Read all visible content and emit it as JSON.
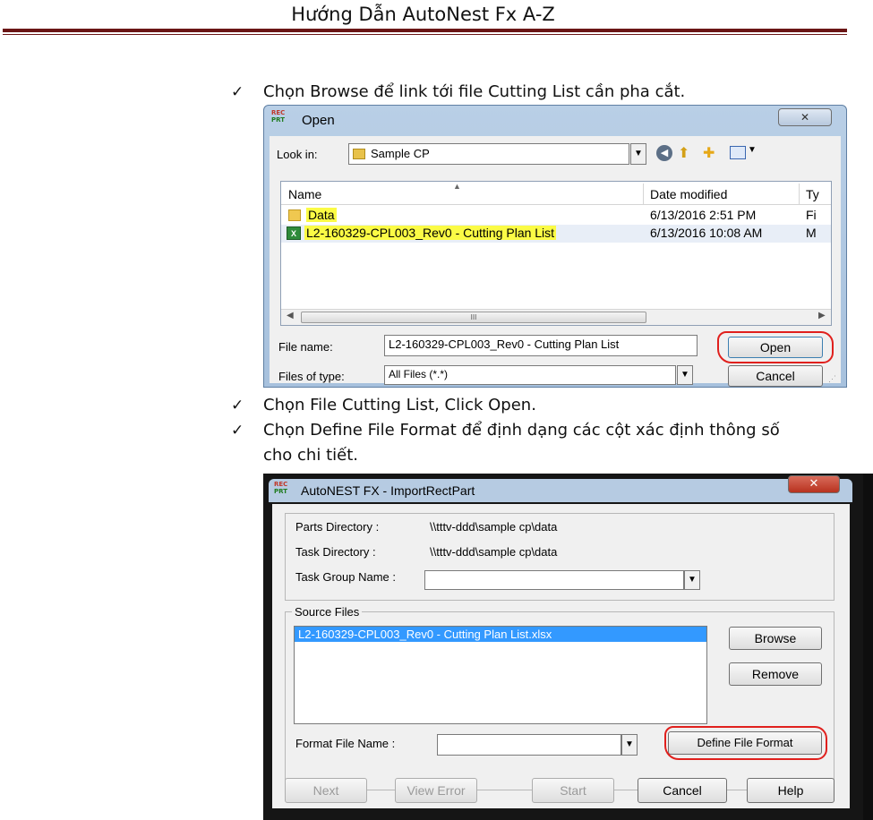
{
  "header": {
    "title": "Hướng Dẫn AutoNest Fx A-Z"
  },
  "bullets": [
    "Chọn Browse để link tới file Cutting List cần pha cắt.",
    "Chọn File Cutting List, Click Open.",
    "Chọn Define File Format để định dạng các cột xác định thông số",
    "cho chi tiết."
  ],
  "check_glyph": "✓",
  "open_dialog": {
    "title": "Open",
    "icon_text_top": "REC",
    "icon_text_bottom": "PRT",
    "close": "✕",
    "look_in_label": "Look in:",
    "look_in_value": "Sample CP",
    "columns": [
      "Name",
      "Date modified",
      "Ty"
    ],
    "rows": [
      {
        "name": "Data",
        "date": "6/13/2016 2:51 PM",
        "type": "Fi",
        "icon": "folder-icon"
      },
      {
        "name": "L2-160329-CPL003_Rev0 - Cutting Plan List",
        "date": "6/13/2016 10:08 AM",
        "type": "M",
        "icon": "excel-file-icon"
      }
    ],
    "scroll_thumb": "III",
    "file_name_label": "File name:",
    "file_name_value": "L2-160329-CPL003_Rev0 - Cutting Plan List",
    "files_of_type_label": "Files of type:",
    "files_of_type_value": "All Files (*.*)",
    "open_button": "Open",
    "cancel_button": "Cancel"
  },
  "import_dialog": {
    "title": "AutoNEST FX - ImportRectPart",
    "close": "✕",
    "parts_directory_label": "Parts Directory :",
    "parts_directory_value": "\\\\tttv-ddd\\sample cp\\data",
    "task_directory_label": "Task Directory :",
    "task_directory_value": "\\\\tttv-ddd\\sample cp\\data",
    "task_group_label": "Task Group Name :",
    "source_files_label": "Source Files",
    "source_file_selected": "L2-160329-CPL003_Rev0 - Cutting Plan List.xlsx",
    "browse_button": "Browse",
    "remove_button": "Remove",
    "format_file_label": "Format File Name :",
    "define_format_button": "Define File Format",
    "next_button": "Next",
    "view_error_button": "View Error",
    "start_button": "Start",
    "cancel_button": "Cancel",
    "help_button": "Help"
  },
  "colors": {
    "header_rule": "#6b1616",
    "highlight": "#fbfb45",
    "annotation_red": "#e0201d",
    "selection_blue": "#3399ff"
  }
}
